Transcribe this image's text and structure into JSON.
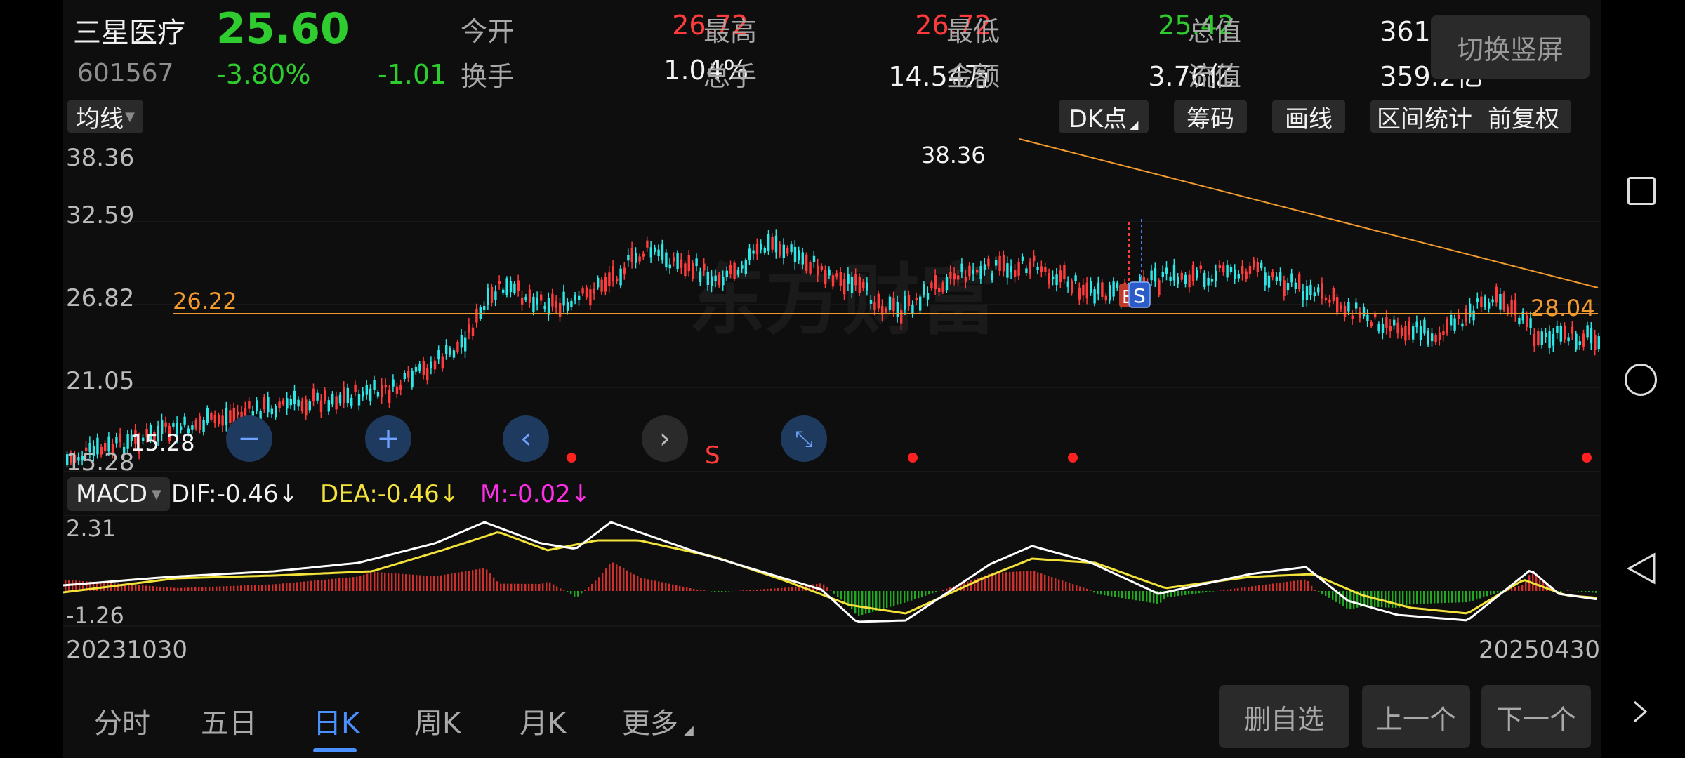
{
  "header": {
    "name": "三星医疗",
    "price": "25.60",
    "code": "601567",
    "change_pct": "-3.80%",
    "change_abs": "-1.01",
    "stats": [
      {
        "label": "今开",
        "value": "26.72",
        "color": "#ff3b3b"
      },
      {
        "label": "最高",
        "value": "26.72",
        "color": "#ff3b3b"
      },
      {
        "label": "最低",
        "value": "25.42",
        "color": "#2ecc2e"
      },
      {
        "label": "总值",
        "value": "361.2亿",
        "color": "#f2f2f2"
      },
      {
        "label": "换手",
        "value": "1.04%",
        "color": "#f2f2f2"
      },
      {
        "label": "总手",
        "value": "14.54万",
        "color": "#f2f2f2"
      },
      {
        "label": "金额",
        "value": "3.76亿",
        "color": "#f2f2f2"
      },
      {
        "label": "流值",
        "value": "359.2亿",
        "color": "#f2f2f2"
      }
    ],
    "switch_label": "切换竖屏"
  },
  "toolbar": {
    "ma_label": "均线",
    "buttons": [
      "DK点",
      "筹码",
      "画线",
      "区间统计",
      "前复权"
    ]
  },
  "chart": {
    "y_labels": [
      "38.36",
      "32.59",
      "26.82",
      "21.05",
      "15.28"
    ],
    "support_label": "26.22",
    "high_label": "38.36",
    "low_label": "15.28",
    "last_label": "28.04",
    "signal_s": "S",
    "signal_b": "B",
    "watermark": "东方财富",
    "colors": {
      "up": "#ff3b3b",
      "down": "#2ee6e6",
      "line": "#f29a2e"
    }
  },
  "macd": {
    "name": "MACD",
    "dif": "DIF:-0.46↓",
    "dea": "DEA:-0.46↓",
    "m": "M:-0.02↓",
    "y_top": "2.31",
    "y_bottom": "-1.26",
    "colors": {
      "dif": "#ffffff",
      "dea": "#f2e23a",
      "m": "#ff2ee6"
    }
  },
  "x_axis": {
    "start": "20231030",
    "end": "20250430"
  },
  "tabs": {
    "items": [
      "分时",
      "五日",
      "日K",
      "周K",
      "月K",
      "更多"
    ],
    "active_index": 2
  },
  "bottom_buttons": [
    "删自选",
    "上一个",
    "下一个"
  ],
  "system_nav": [
    "square-icon",
    "circle-icon",
    "back-triangle-icon",
    "chevron-right-icon"
  ]
}
